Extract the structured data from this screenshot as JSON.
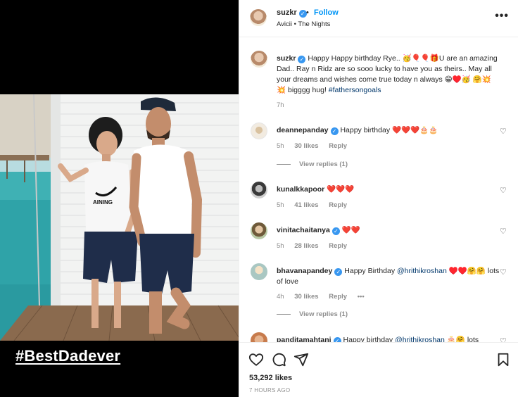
{
  "post": {
    "hashtag_overlay": "#BestDadever",
    "shirt_text": "AINING"
  },
  "header": {
    "username": "suzkr",
    "separator": "•",
    "follow_label": "Follow",
    "song": "Avicii • The Nights",
    "more_icon": "more-options-icon"
  },
  "caption": {
    "username": "suzkr",
    "text": "Happy Happy birthday Rye.. 🥳🎈🎈🎁U are an amazing Dad.. Ray n Ridz are so sooo lucky to have you as theirs.. May all your dreams and wishes come true today n always 😁♥️🥳 🤗💥 💥 bigggg hug!",
    "hashtag": "#fathersongoals",
    "time": "7h"
  },
  "comments": [
    {
      "username": "deannepanday",
      "text": "Happy birthday ❤️❤️❤️🎂🎂",
      "time": "5h",
      "likes": "30 likes",
      "reply": "Reply",
      "view_replies": "View replies (1)"
    },
    {
      "username": "kunalkkapoor",
      "text": "❤️❤️❤️",
      "time": "5h",
      "likes": "41 likes",
      "reply": "Reply"
    },
    {
      "username": "vinitachaitanya",
      "text": "❤️❤️",
      "time": "5h",
      "likes": "28 likes",
      "reply": "Reply"
    },
    {
      "username": "bhavanapandey",
      "text_prefix": "Happy Birthday ",
      "mention": "@hrithikroshan",
      "text_suffix": " ♥️♥️🤗🤗 lots of love",
      "time": "4h",
      "likes": "30 likes",
      "reply": "Reply",
      "more": "•••",
      "view_replies": "View replies (1)"
    },
    {
      "username": "panditamahtani",
      "text_prefix": "Happy birthday ",
      "mention": "@hrithikroshan",
      "text_suffix": " 🎂🤗 lots"
    }
  ],
  "actions": {
    "likes": "53,292 likes",
    "time_ago": "7 HOURS AGO"
  }
}
